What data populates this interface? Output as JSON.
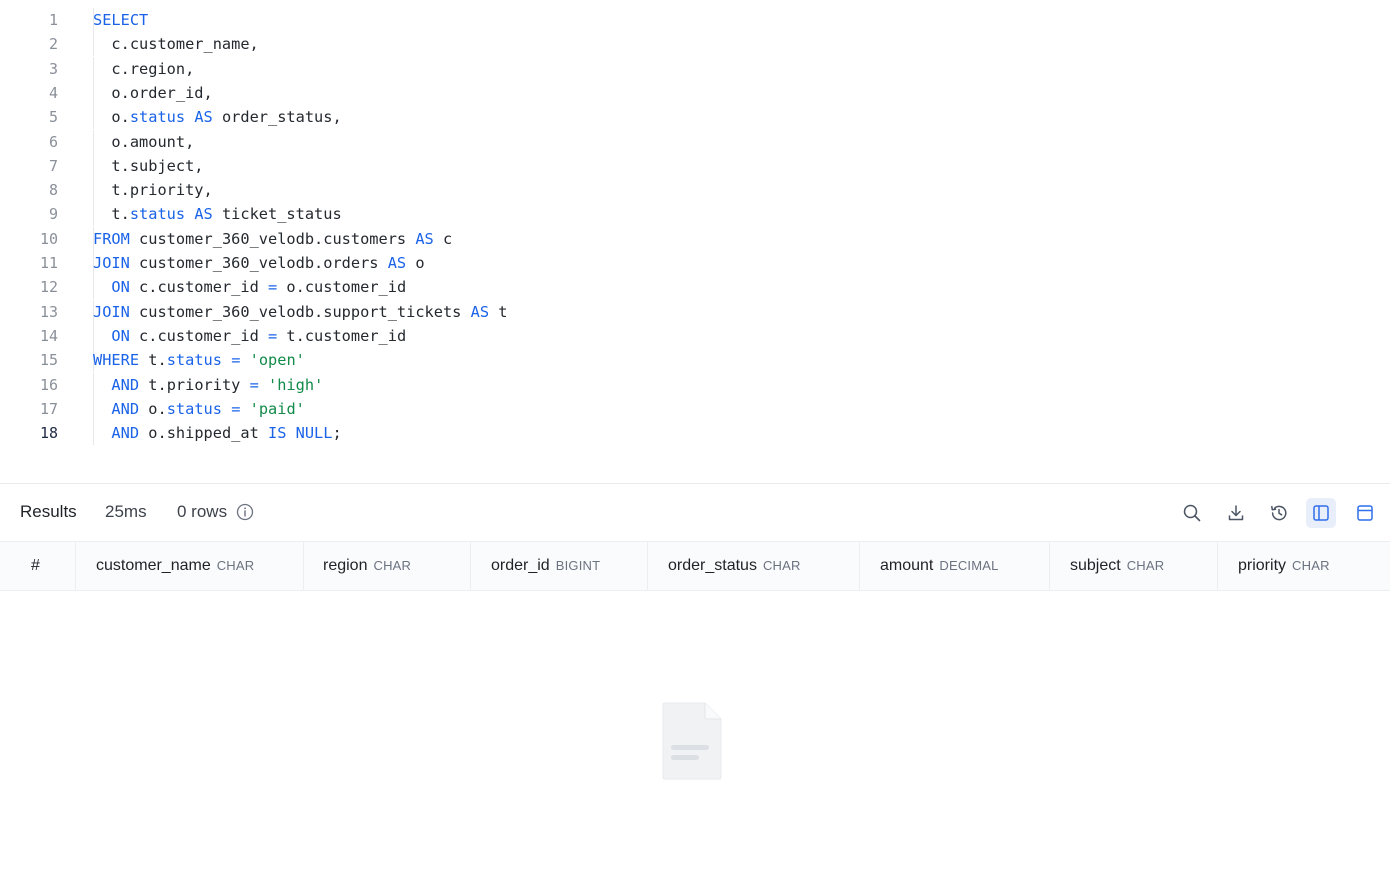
{
  "editor": {
    "active_line": 18,
    "lines": [
      {
        "n": "1",
        "tokens": [
          {
            "t": "SELECT",
            "k": "kw"
          }
        ]
      },
      {
        "n": "2",
        "tokens": [
          {
            "t": "  c.customer_name,",
            "k": "plain"
          }
        ]
      },
      {
        "n": "3",
        "tokens": [
          {
            "t": "  c.region,",
            "k": "plain"
          }
        ]
      },
      {
        "n": "4",
        "tokens": [
          {
            "t": "  o.order_id,",
            "k": "plain"
          }
        ]
      },
      {
        "n": "5",
        "tokens": [
          {
            "t": "  o.",
            "k": "plain"
          },
          {
            "t": "status",
            "k": "kw"
          },
          {
            "t": " ",
            "k": "plain"
          },
          {
            "t": "AS",
            "k": "kw"
          },
          {
            "t": " order_status,",
            "k": "plain"
          }
        ]
      },
      {
        "n": "6",
        "tokens": [
          {
            "t": "  o.amount,",
            "k": "plain"
          }
        ]
      },
      {
        "n": "7",
        "tokens": [
          {
            "t": "  t.subject,",
            "k": "plain"
          }
        ]
      },
      {
        "n": "8",
        "tokens": [
          {
            "t": "  t.priority,",
            "k": "plain"
          }
        ]
      },
      {
        "n": "9",
        "tokens": [
          {
            "t": "  t.",
            "k": "plain"
          },
          {
            "t": "status",
            "k": "kw"
          },
          {
            "t": " ",
            "k": "plain"
          },
          {
            "t": "AS",
            "k": "kw"
          },
          {
            "t": " ticket_status",
            "k": "plain"
          }
        ]
      },
      {
        "n": "10",
        "tokens": [
          {
            "t": "FROM",
            "k": "kw"
          },
          {
            "t": " customer_360_velodb.customers ",
            "k": "plain"
          },
          {
            "t": "AS",
            "k": "kw"
          },
          {
            "t": " c",
            "k": "plain"
          }
        ]
      },
      {
        "n": "11",
        "tokens": [
          {
            "t": "JOIN",
            "k": "kw"
          },
          {
            "t": " customer_360_velodb.orders ",
            "k": "plain"
          },
          {
            "t": "AS",
            "k": "kw"
          },
          {
            "t": " o",
            "k": "plain"
          }
        ]
      },
      {
        "n": "12",
        "tokens": [
          {
            "t": "  ",
            "k": "plain"
          },
          {
            "t": "ON",
            "k": "kw"
          },
          {
            "t": " c.customer_id ",
            "k": "plain"
          },
          {
            "t": "=",
            "k": "kw"
          },
          {
            "t": " o.customer_id",
            "k": "plain"
          }
        ]
      },
      {
        "n": "13",
        "tokens": [
          {
            "t": "JOIN",
            "k": "kw"
          },
          {
            "t": " customer_360_velodb.support_tickets ",
            "k": "plain"
          },
          {
            "t": "AS",
            "k": "kw"
          },
          {
            "t": " t",
            "k": "plain"
          }
        ]
      },
      {
        "n": "14",
        "tokens": [
          {
            "t": "  ",
            "k": "plain"
          },
          {
            "t": "ON",
            "k": "kw"
          },
          {
            "t": " c.customer_id ",
            "k": "plain"
          },
          {
            "t": "=",
            "k": "kw"
          },
          {
            "t": " t.customer_id",
            "k": "plain"
          }
        ]
      },
      {
        "n": "15",
        "tokens": [
          {
            "t": "WHERE",
            "k": "kw"
          },
          {
            "t": " t.",
            "k": "plain"
          },
          {
            "t": "status",
            "k": "kw"
          },
          {
            "t": " ",
            "k": "plain"
          },
          {
            "t": "=",
            "k": "kw"
          },
          {
            "t": " ",
            "k": "plain"
          },
          {
            "t": "'open'",
            "k": "str"
          }
        ]
      },
      {
        "n": "16",
        "tokens": [
          {
            "t": "  ",
            "k": "plain"
          },
          {
            "t": "AND",
            "k": "kw"
          },
          {
            "t": " t.priority ",
            "k": "plain"
          },
          {
            "t": "=",
            "k": "kw"
          },
          {
            "t": " ",
            "k": "plain"
          },
          {
            "t": "'high'",
            "k": "str"
          }
        ]
      },
      {
        "n": "17",
        "tokens": [
          {
            "t": "  ",
            "k": "plain"
          },
          {
            "t": "AND",
            "k": "kw"
          },
          {
            "t": " o.",
            "k": "plain"
          },
          {
            "t": "status",
            "k": "kw"
          },
          {
            "t": " ",
            "k": "plain"
          },
          {
            "t": "=",
            "k": "kw"
          },
          {
            "t": " ",
            "k": "plain"
          },
          {
            "t": "'paid'",
            "k": "str"
          }
        ]
      },
      {
        "n": "18",
        "tokens": [
          {
            "t": "  ",
            "k": "plain"
          },
          {
            "t": "AND",
            "k": "kw"
          },
          {
            "t": " o.shipped_at ",
            "k": "plain"
          },
          {
            "t": "IS",
            "k": "kw"
          },
          {
            "t": " ",
            "k": "plain"
          },
          {
            "t": "NULL",
            "k": "kw"
          },
          {
            "t": ";",
            "k": "plain"
          }
        ]
      }
    ]
  },
  "results": {
    "title": "Results",
    "elapsed": "25ms",
    "row_count": "0 rows",
    "toolbar": {
      "search_icon": "search-icon",
      "download_icon": "download-icon",
      "history_icon": "history-icon",
      "split_vertical_icon": "panel-left-icon",
      "split_horizontal_icon": "panel-top-icon",
      "selected": "panel-left-icon"
    },
    "columns": [
      {
        "name": "#",
        "type": ""
      },
      {
        "name": "customer_name",
        "type": "CHAR"
      },
      {
        "name": "region",
        "type": "CHAR"
      },
      {
        "name": "order_id",
        "type": "BIGINT"
      },
      {
        "name": "order_status",
        "type": "CHAR"
      },
      {
        "name": "amount",
        "type": "DECIMAL"
      },
      {
        "name": "subject",
        "type": "CHAR"
      },
      {
        "name": "priority",
        "type": "CHAR"
      }
    ],
    "empty_icon": "empty-document-icon"
  },
  "colors": {
    "keyword": "#1a63e8",
    "string": "#128a49",
    "selected_tool_bg": "#e9eefb"
  }
}
